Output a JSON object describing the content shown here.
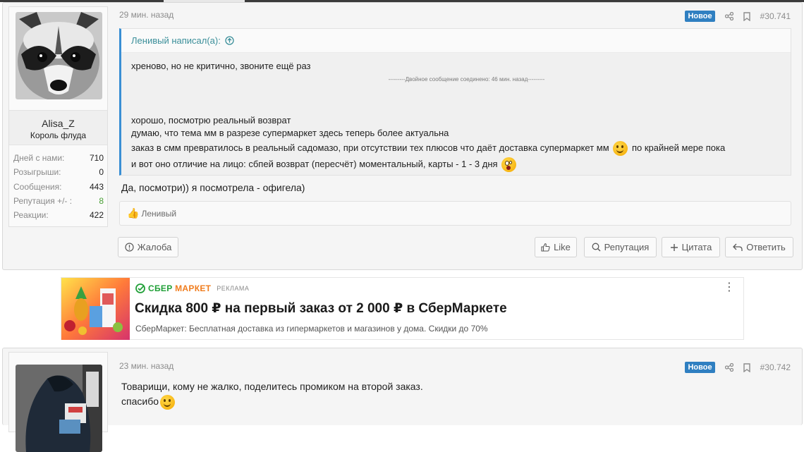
{
  "post1": {
    "user": {
      "name": "Alisa_Z",
      "title": "Король флуда"
    },
    "stats": [
      {
        "label": "Дней с нами:",
        "value": "710"
      },
      {
        "label": "Розыгрыши:",
        "value": "0"
      },
      {
        "label": "Сообщения:",
        "value": "443"
      },
      {
        "label": "Репутация +/- :",
        "value": "8"
      },
      {
        "label": "Реакции:",
        "value": "422"
      }
    ],
    "time": "29 мин. назад",
    "badge": "Новое",
    "post_number": "#30.741",
    "quote": {
      "author": "Ленивый написал(а):",
      "line1": "хреново, но не критично, звоните ещё раз",
      "merge_note": "---------Двойное сообщение соединено: 46 мин. назад---------",
      "line2": "хорошо, посмотрю реальный возврат",
      "line3": "думаю, что тема мм в разрезе супермаркет здесь теперь более актуальна",
      "line4a": "заказ в смм превратилось в реальный садомазо, при отсутствии тех плюсов что даёт доставка супермаркет мм",
      "line4b": "по крайней мере пока",
      "line5": "и вот оно отличие на лицо: сбпей возврат (пересчёт) моментальный, карты - 1 - 3 дня"
    },
    "message": "Да, посмотри)) я посмотрела - офигела)",
    "reaction_user": "Ленивый",
    "buttons": {
      "report": "Жалоба",
      "like": "Like",
      "reputation": "Репутация",
      "quote": "Цитата",
      "reply": "Ответить"
    }
  },
  "ad": {
    "brand_green": "СБЕР",
    "brand_orange": "МАРКЕТ",
    "label": "РЕКЛАМА",
    "title": "Скидка 800 ₽ на первый заказ от 2 000 ₽ в СберМаркете",
    "description": "СберМаркет: Бесплатная доставка из гипермаркетов и магазинов у дома. Скидки до 70%"
  },
  "post2": {
    "time": "23 мин. назад",
    "badge": "Новое",
    "post_number": "#30.742",
    "line1": "Товарищи, кому не жалко, поделитесь промиком на второй заказ.",
    "line2": "спасибо"
  },
  "colors": {
    "accent": "#2f7fc1",
    "quote_border": "#3a8fd4",
    "reputation_positive": "#4a9f35",
    "sber_green": "#21a038",
    "sber_orange": "#f07d1e"
  }
}
